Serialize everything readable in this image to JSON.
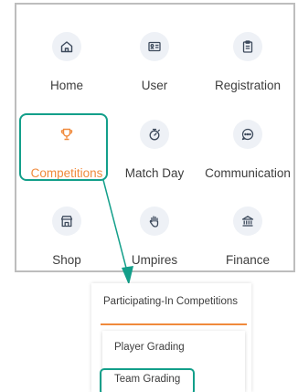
{
  "menu": {
    "items": [
      {
        "label": "Home",
        "icon": "home-icon"
      },
      {
        "label": "User",
        "icon": "user-card-icon"
      },
      {
        "label": "Registration",
        "icon": "clipboard-icon"
      },
      {
        "label": "Competitions",
        "icon": "trophy-icon",
        "active": true
      },
      {
        "label": "Match Day",
        "icon": "stopwatch-icon"
      },
      {
        "label": "Communication",
        "icon": "chat-icon"
      },
      {
        "label": "Shop",
        "icon": "shop-icon"
      },
      {
        "label": "Umpires",
        "icon": "hand-icon"
      },
      {
        "label": "Finance",
        "icon": "bank-icon"
      }
    ]
  },
  "dropdown": {
    "header": "Participating-In Competitions",
    "items": [
      {
        "label": "Player Grading"
      },
      {
        "label": "Team Grading"
      }
    ]
  },
  "colors": {
    "accent": "#f08a3c",
    "highlight": "#139f8a",
    "icon_circle": "#eef1f6",
    "icon": "#3d4a5c"
  }
}
